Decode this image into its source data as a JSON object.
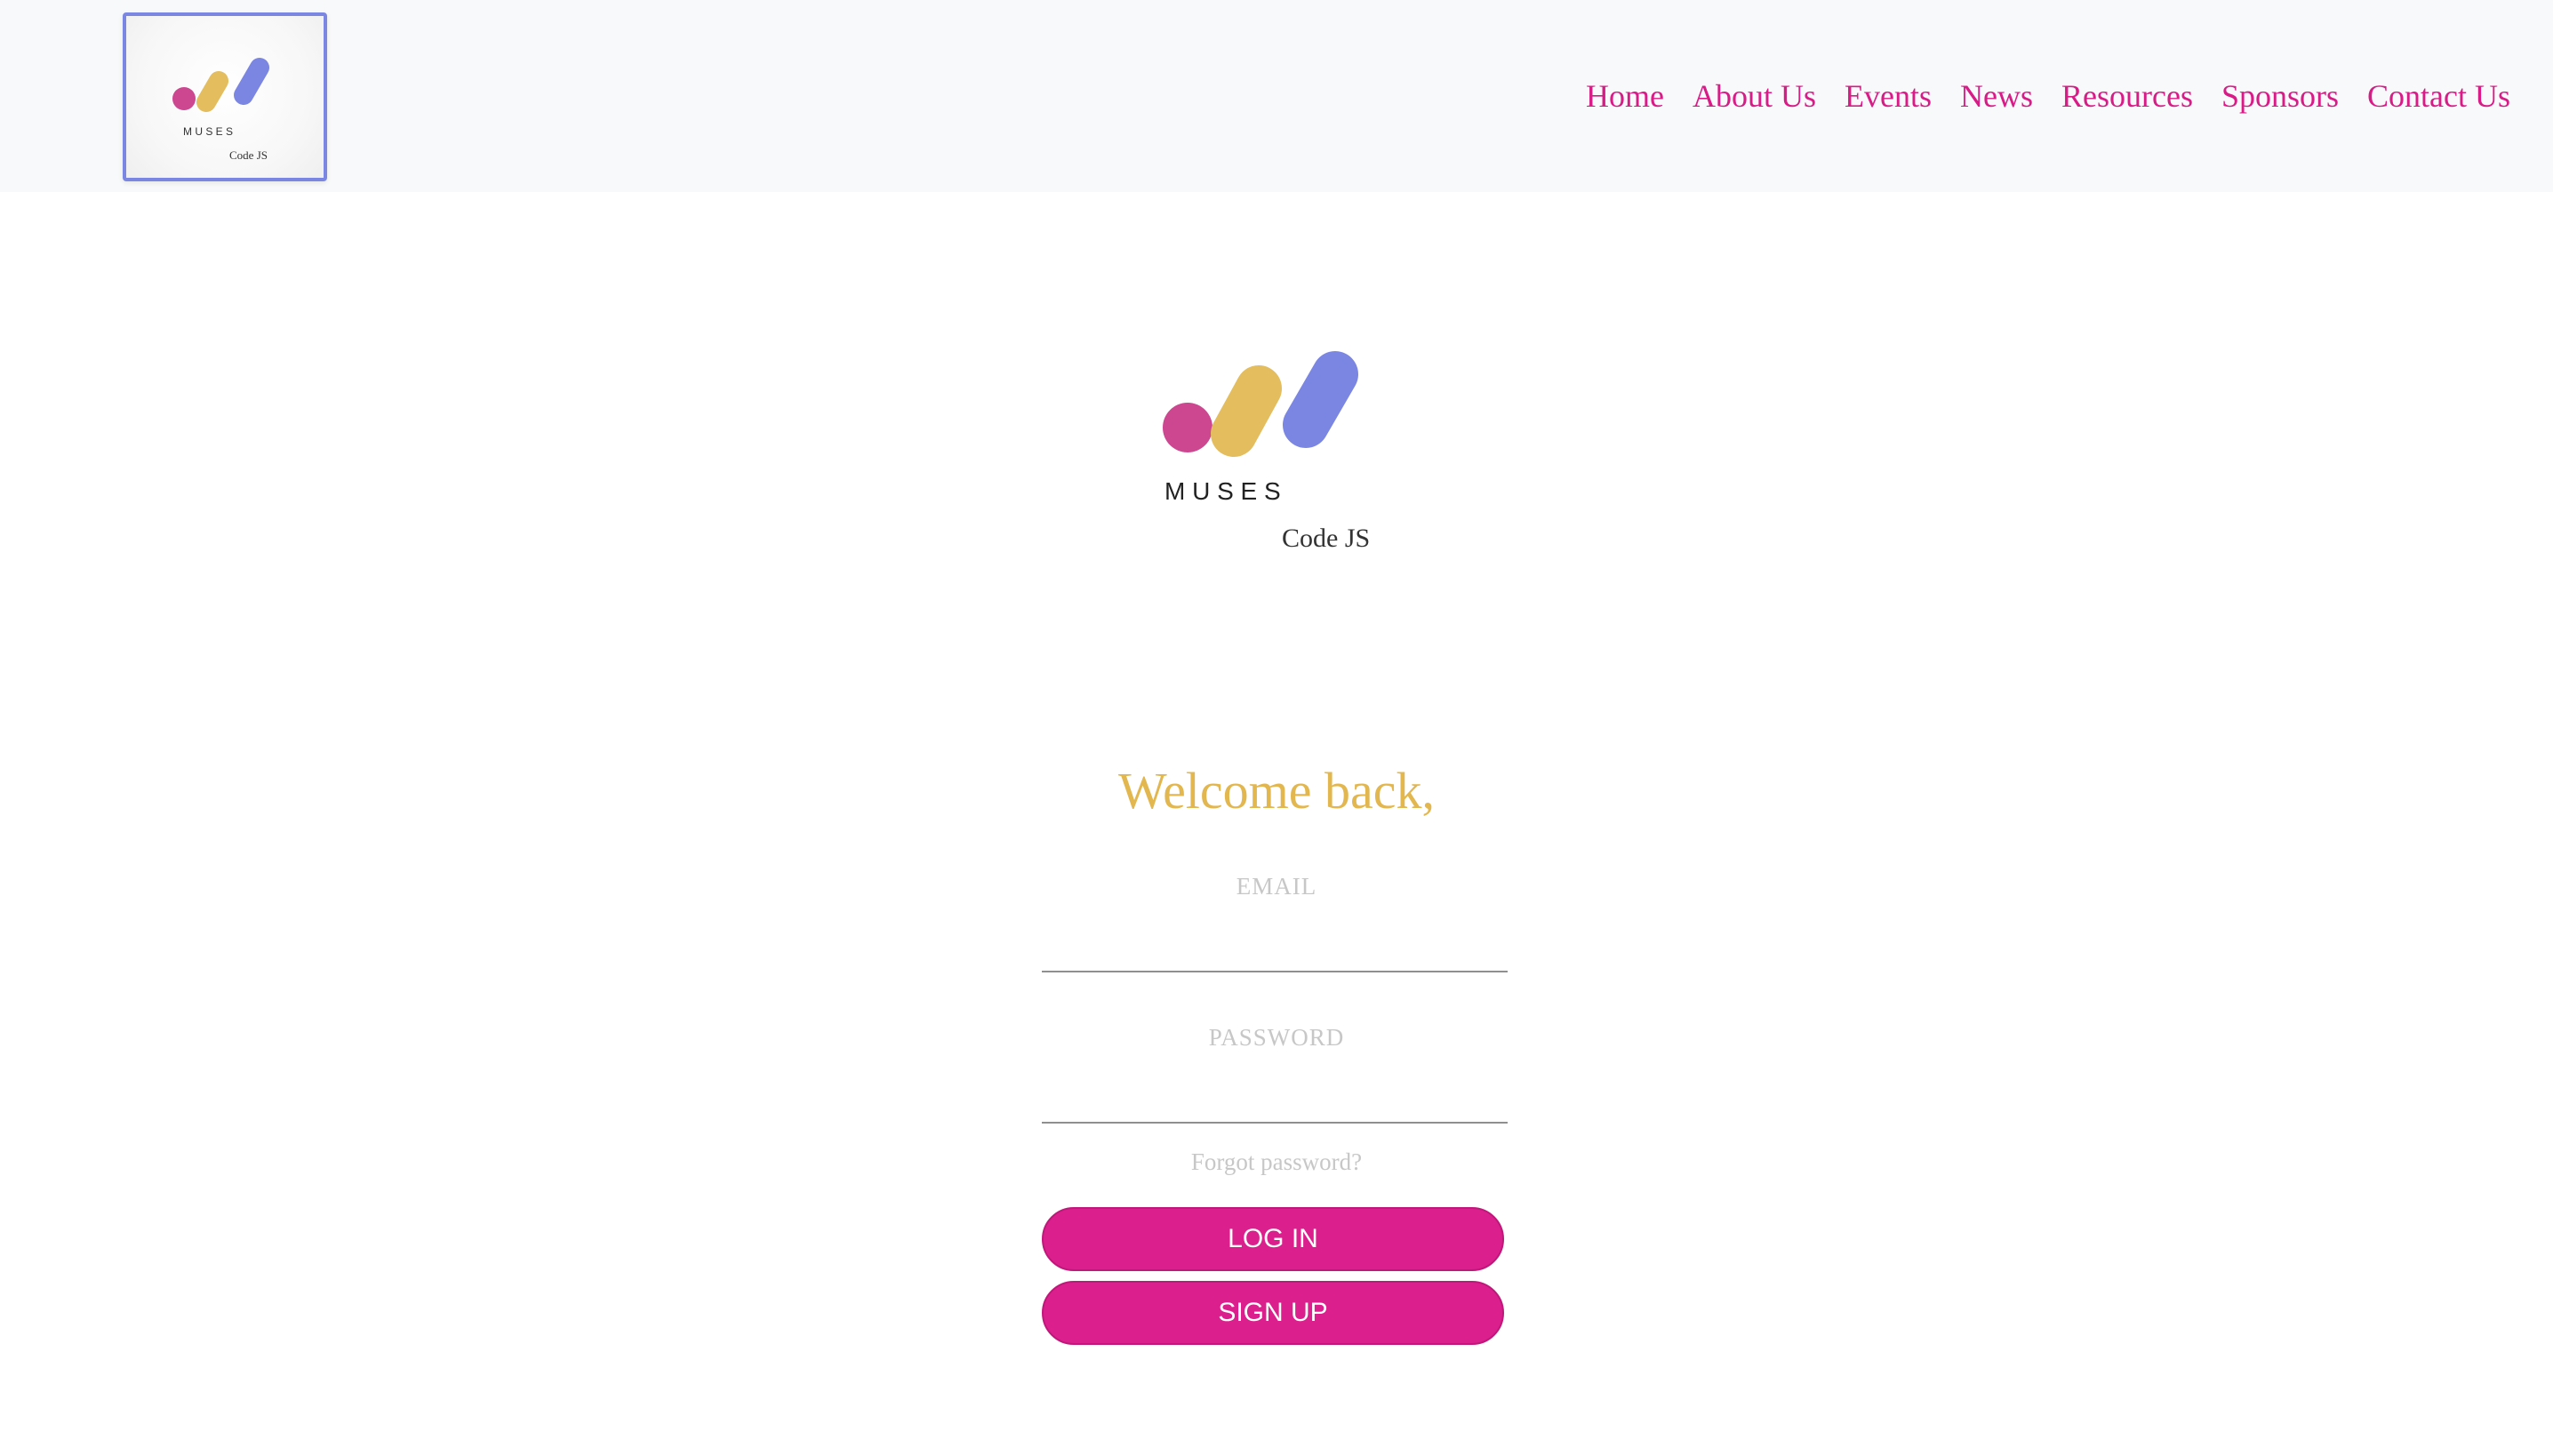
{
  "brand": {
    "wordmark": "M U S E S",
    "subtitle": "Code JS"
  },
  "nav": {
    "items": [
      "Home",
      "About Us",
      "Events",
      "News",
      "Resources",
      "Sponsors",
      "Contact Us"
    ]
  },
  "login": {
    "heading": "Welcome back,",
    "email_label": "EMAIL",
    "email_value": "",
    "password_label": "PASSWORD",
    "password_value": "",
    "forgot_link": "Forgot password?",
    "login_button": "LOG IN",
    "signup_button": "SIGN UP"
  },
  "colors": {
    "accent_pink": "#db1f8c",
    "accent_gold": "#e3b74f",
    "accent_blue": "#7b86e2",
    "header_bg": "#f8f9fa"
  }
}
